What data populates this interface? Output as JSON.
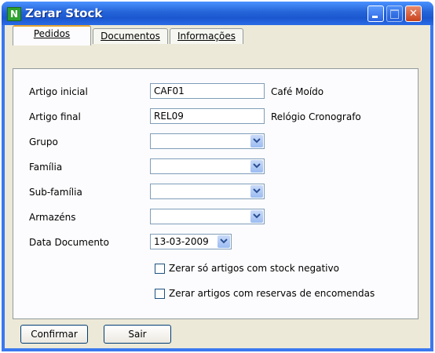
{
  "window": {
    "title": "Zerar Stock",
    "app_icon_letter": "N"
  },
  "tabs": [
    {
      "label": "Pedidos",
      "active": true
    },
    {
      "label": "Documentos",
      "active": false
    },
    {
      "label": "Informações",
      "active": false
    }
  ],
  "form": {
    "artigo_inicial": {
      "label": "Artigo inicial",
      "value": "CAF01",
      "description": "Café Moído"
    },
    "artigo_final": {
      "label": "Artigo final",
      "value": "REL09",
      "description": "Relógio Cronografo"
    },
    "grupo": {
      "label": "Grupo",
      "value": ""
    },
    "familia": {
      "label": "Família",
      "value": ""
    },
    "subfamilia": {
      "label": "Sub-família",
      "value": ""
    },
    "armazens": {
      "label": "Armazéns",
      "value": ""
    },
    "data_documento": {
      "label": "Data Documento",
      "value": "13-03-2009"
    },
    "check_negativo": {
      "label": "Zerar só artigos com stock negativo",
      "checked": false
    },
    "check_reservas": {
      "label": "Zerar artigos com reservas de encomendas",
      "checked": false
    }
  },
  "buttons": {
    "confirmar": "Confirmar",
    "sair": "Sair"
  },
  "icons": {
    "minimize": "minimize-icon",
    "maximize": "maximize-icon",
    "close": "close-icon",
    "dropdown": "chevron-down-icon"
  },
  "colors": {
    "titlebar": "#2463d8",
    "client": "#ece9d8",
    "close_button": "#c8421c",
    "active_tab_accent": "#e6a532"
  }
}
